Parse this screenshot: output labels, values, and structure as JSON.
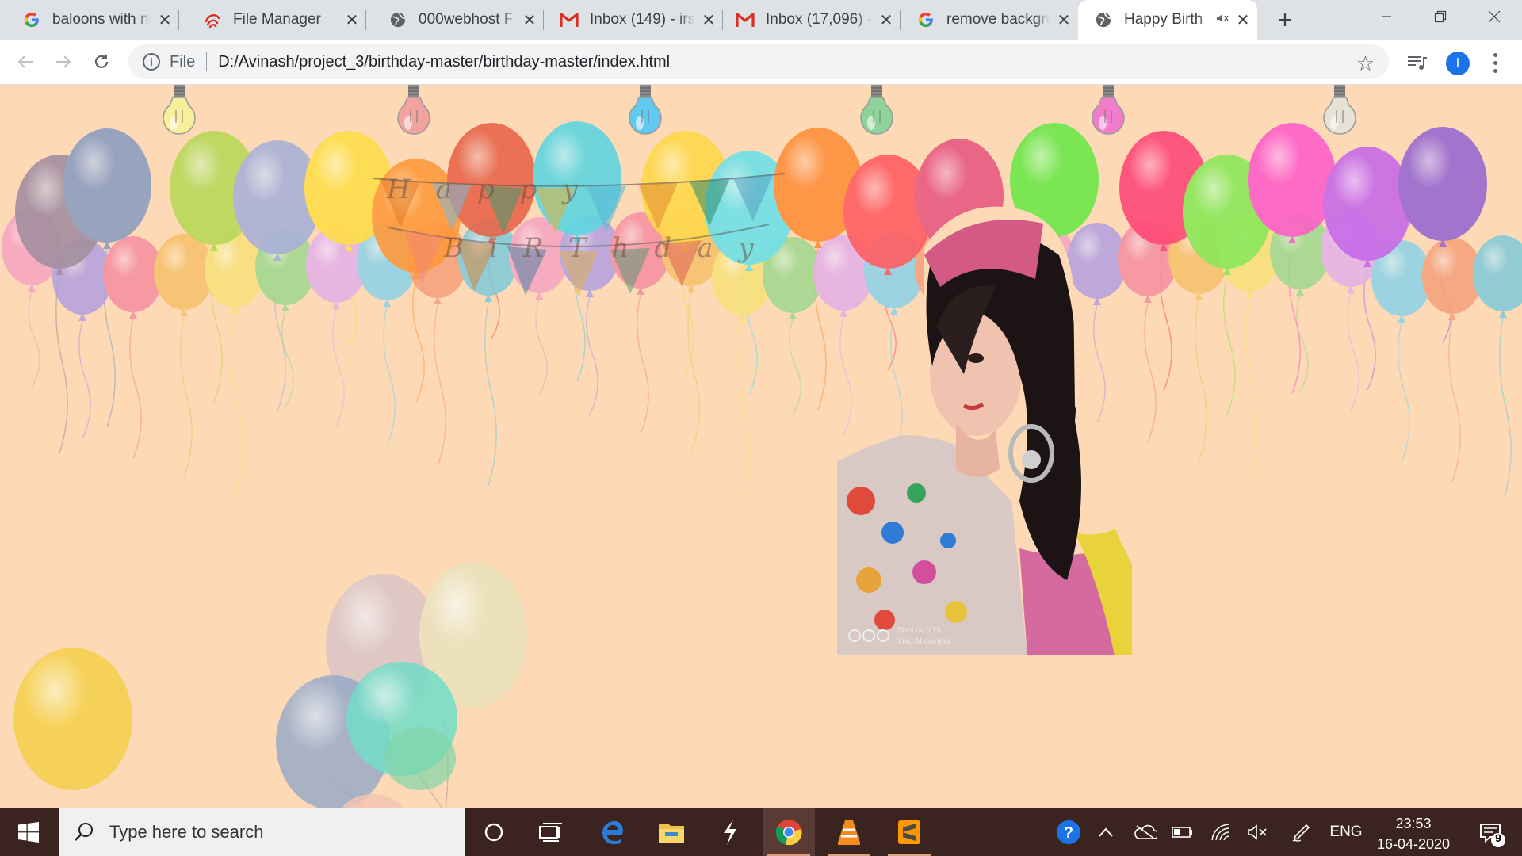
{
  "tabs": [
    {
      "title": "baloons with no",
      "favicon": "google-g-icon"
    },
    {
      "title": "File Manager",
      "favicon": "filemanager-swirl-icon"
    },
    {
      "title": "000webhost File",
      "favicon": "globe-icon"
    },
    {
      "title": "Inbox (149) - irs",
      "favicon": "gmail-icon"
    },
    {
      "title": "Inbox (17,096) -",
      "favicon": "gmail-icon"
    },
    {
      "title": "remove backgro",
      "favicon": "google-g-icon"
    },
    {
      "title": "Happy Birth",
      "favicon": "globe-icon",
      "active": true,
      "audio": true
    }
  ],
  "toolbar": {
    "scheme_label": "File",
    "url": "D:/Avinash/project_3/birthday-master/birthday-master/index.html",
    "profile_initial": "I"
  },
  "page": {
    "banner_row1": "Happy",
    "banner_row2": "BiRThday",
    "photo_watermark_line1": "Shot on Y15",
    "photo_watermark_line2": "Vivo AI camera",
    "bulb_colors": [
      "#f7ef9a",
      "#f2a3a0",
      "#5fc9f0",
      "#8fd39a",
      "#f07ccb",
      "#e6e2d6"
    ]
  },
  "taskbar": {
    "search_placeholder": "Type here to search",
    "language": "ENG",
    "time": "23:53",
    "date": "16-04-2020",
    "notification_count": "9"
  },
  "colors": {
    "page_background": "#fdd9b5",
    "taskbar": "#3b2320",
    "tabstrip": "#dee1e6"
  }
}
